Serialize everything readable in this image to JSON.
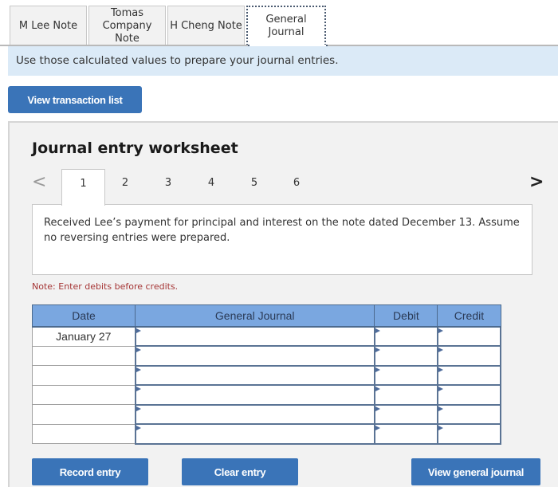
{
  "tabs": [
    {
      "label": "M Lee Note",
      "active": false
    },
    {
      "label": "Tomas Company Note",
      "active": false
    },
    {
      "label": "H Cheng Note",
      "active": false
    },
    {
      "label": "General Journal",
      "active": true
    }
  ],
  "instruction": "Use those calculated values to prepare your journal entries.",
  "buttons": {
    "view_transaction_list": "View transaction list",
    "record_entry": "Record entry",
    "clear_entry": "Clear entry",
    "view_general_journal": "View general journal"
  },
  "worksheet": {
    "title": "Journal entry worksheet",
    "pager": {
      "prev_icon": "chevron-left-icon",
      "next_icon": "chevron-right-icon",
      "prev_glyph": "<",
      "next_glyph": ">",
      "pages": [
        "1",
        "2",
        "3",
        "4",
        "5",
        "6"
      ],
      "current": "1"
    },
    "description": "Received Lee’s payment for principal and interest on the note dated December 13. Assume no reversing entries were prepared.",
    "note": "Note: Enter debits before credits.",
    "table": {
      "headers": [
        "Date",
        "General Journal",
        "Debit",
        "Credit"
      ],
      "rows": [
        {
          "date": "January 27",
          "account": "",
          "debit": "",
          "credit": ""
        },
        {
          "date": "",
          "account": "",
          "debit": "",
          "credit": ""
        },
        {
          "date": "",
          "account": "",
          "debit": "",
          "credit": ""
        },
        {
          "date": "",
          "account": "",
          "debit": "",
          "credit": ""
        },
        {
          "date": "",
          "account": "",
          "debit": "",
          "credit": ""
        },
        {
          "date": "",
          "account": "",
          "debit": "",
          "credit": ""
        }
      ]
    }
  }
}
